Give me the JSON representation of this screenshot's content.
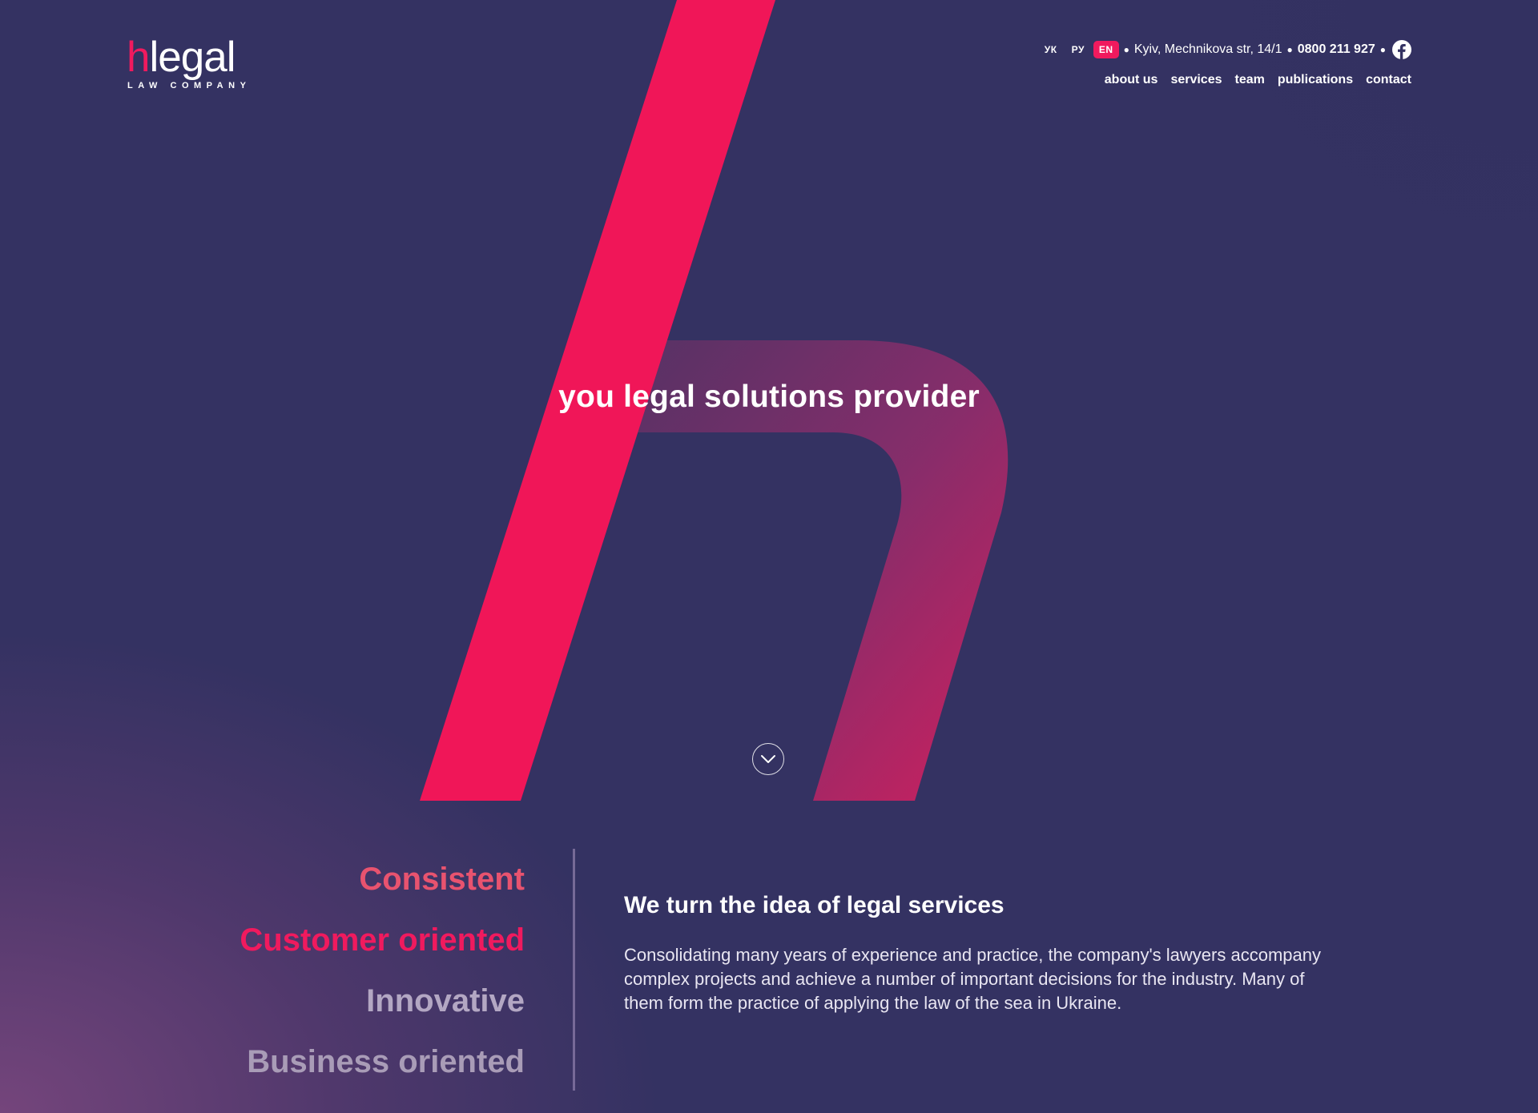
{
  "brand": {
    "logo_h": "h",
    "logo_rest": "legal",
    "logo_sub": "LAW COMPANY",
    "accent": "#f01a5e",
    "background": "#343262"
  },
  "topbar": {
    "languages": [
      "УК",
      "РУ",
      "EN"
    ],
    "active_language": "EN",
    "address": "Kyiv, Mechnikova str, 14/1",
    "phone": "0800 211 927",
    "social_icon": "facebook-icon"
  },
  "nav": {
    "items": [
      "about us",
      "services",
      "team",
      "publications",
      "contact"
    ]
  },
  "hero": {
    "tagline": "you legal solutions provider",
    "scroll_icon": "chevron-down-icon"
  },
  "values": [
    "Consistent",
    "Customer oriented",
    "Innovative",
    "Business oriented"
  ],
  "about": {
    "heading": "We turn the idea of legal services",
    "body": "Consolidating many years of experience and practice, the company's lawyers accompany complex projects and achieve a number of important decisions for the industry. Many of them form the practice of applying the law of the sea in Ukraine."
  }
}
